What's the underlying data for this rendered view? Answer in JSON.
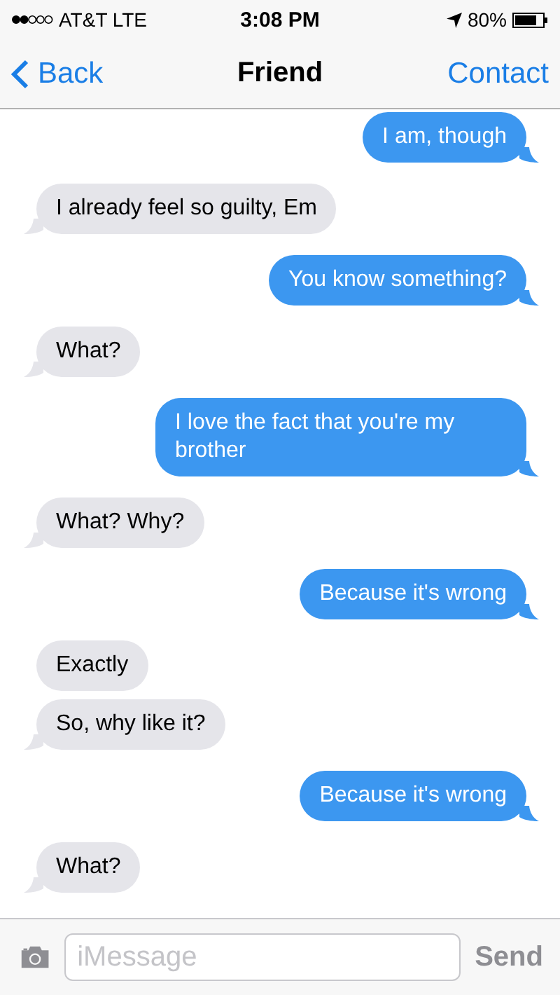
{
  "status_bar": {
    "carrier": "AT&T LTE",
    "time": "3:08 PM",
    "battery": "80%"
  },
  "nav": {
    "back": "Back",
    "title": "Friend",
    "action": "Contact"
  },
  "messages": [
    {
      "kind": "sent",
      "text": "I am, though",
      "tail": true
    },
    {
      "kind": "received",
      "text": "I already feel so guilty, Em",
      "tail": true
    },
    {
      "kind": "sent",
      "text": "You know something?",
      "tail": true
    },
    {
      "kind": "received",
      "text": "What?",
      "tail": true
    },
    {
      "kind": "sent",
      "text": "I love the fact that you're my brother",
      "tail": true
    },
    {
      "kind": "received",
      "text": "What? Why?",
      "tail": true
    },
    {
      "kind": "sent",
      "text": "Because it's wrong",
      "tail": true
    },
    {
      "kind": "received",
      "text": "Exactly",
      "tail": false
    },
    {
      "kind": "received",
      "text": "So, why like it?",
      "tail": true
    },
    {
      "kind": "sent",
      "text": "Because it's wrong",
      "tail": true
    },
    {
      "kind": "received",
      "text": "What?",
      "tail": true
    }
  ],
  "composer": {
    "placeholder": "iMessage",
    "send": "Send"
  }
}
